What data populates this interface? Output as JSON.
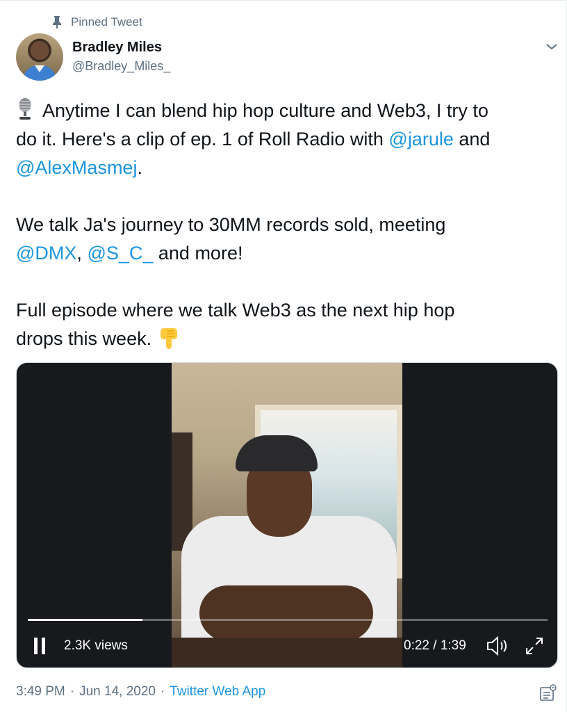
{
  "pinned": {
    "label": "Pinned Tweet",
    "icon": "pin-icon"
  },
  "author": {
    "name": "Bradley Miles",
    "handle": "@Bradley_Miles_"
  },
  "tweet": {
    "line1_pre": "Anytime I can blend hip hop culture and Web3, I try to",
    "line2_pre": "do it. Here's a clip of ep. 1 of Roll Radio with ",
    "mention_jarule": "@jarule",
    "line2_post": " and",
    "mention_alex": "@AlexMasmej",
    "line3_post": ".",
    "line5": "We talk Ja's journey to 30MM records sold, meeting",
    "mention_dmx": "@DMX",
    "comma": ", ",
    "mention_sc": "@S_C_",
    "line6_post": "  and more!",
    "line8": "Full episode where we talk Web3 as the next hip hop",
    "line9": "drops this week."
  },
  "video": {
    "views": "2.3K views",
    "time": "0:22 / 1:39",
    "progress": 0.22
  },
  "meta": {
    "time": "3:49 PM",
    "dot": "·",
    "date": "Jun 14, 2020",
    "app": "Twitter Web App"
  },
  "colors": {
    "link": "#1b95e0",
    "secondary": "#5b7083",
    "text": "#0f1419"
  }
}
